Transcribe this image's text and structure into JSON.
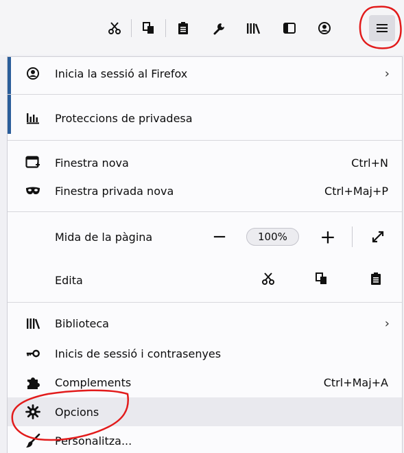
{
  "toolbar": {
    "icons": [
      "cut-icon",
      "copy-icon",
      "paste-icon",
      "wrench-icon",
      "library-icon",
      "sidebar-icon",
      "account-icon",
      "hamburger-menu-icon"
    ]
  },
  "menu": {
    "sign_in": {
      "label": "Inicia la sessió al Firefox"
    },
    "privacy": {
      "label": "Proteccions de privadesa"
    },
    "new_window": {
      "label": "Finestra nova",
      "shortcut": "Ctrl+N"
    },
    "private_window": {
      "label": "Finestra privada nova",
      "shortcut": "Ctrl+Maj+P"
    },
    "zoom": {
      "label": "Mida de la pàgina",
      "minus": "−",
      "value": "100%",
      "plus": "+"
    },
    "edit": {
      "label": "Edita"
    },
    "library": {
      "label": "Biblioteca"
    },
    "logins": {
      "label": "Inicis de sessió i contrasenyes"
    },
    "addons": {
      "label": "Complements",
      "shortcut": "Ctrl+Maj+A"
    },
    "options": {
      "label": "Opcions"
    },
    "customize": {
      "label": "Personalitza..."
    },
    "chevron": "›"
  },
  "annotation_color": "#e21b1b"
}
